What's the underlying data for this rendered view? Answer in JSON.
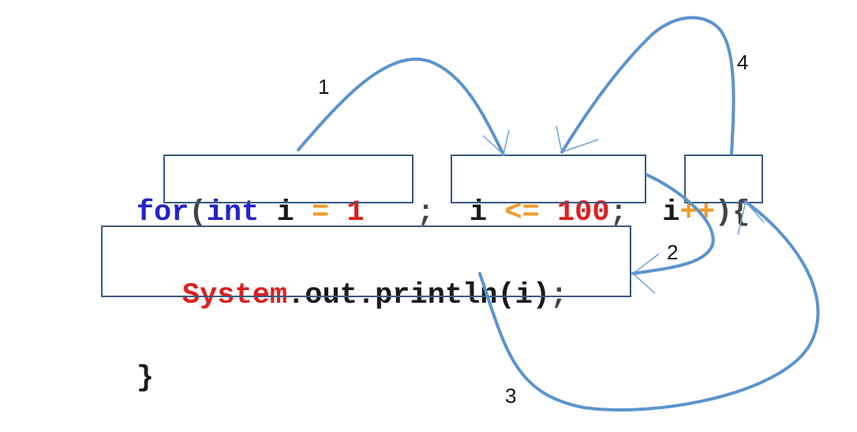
{
  "code": {
    "line1": {
      "for": "for",
      "open_paren": "(",
      "int": "int",
      "var": "i",
      "assign": "=",
      "init": "1",
      "semi1": ";",
      "cond_var": "i",
      "cond_op": "<=",
      "limit": "100",
      "semi2": ";",
      "inc_var": "i",
      "inc_op": "++",
      "close_paren": ")",
      "open_brace": "{"
    },
    "line2": {
      "system": "System",
      "rest": ".out.println(i)",
      "semi": ";"
    },
    "line3": {
      "close_brace": "}"
    }
  },
  "steps": {
    "s1": "1",
    "s2": "2",
    "s3": "3",
    "s4": "4"
  },
  "colors": {
    "keyword": "#2424c8",
    "literal": "#e01e1e",
    "operator": "#f39a2a",
    "arrow": "#5b93cf",
    "box": "#3b5a80"
  }
}
